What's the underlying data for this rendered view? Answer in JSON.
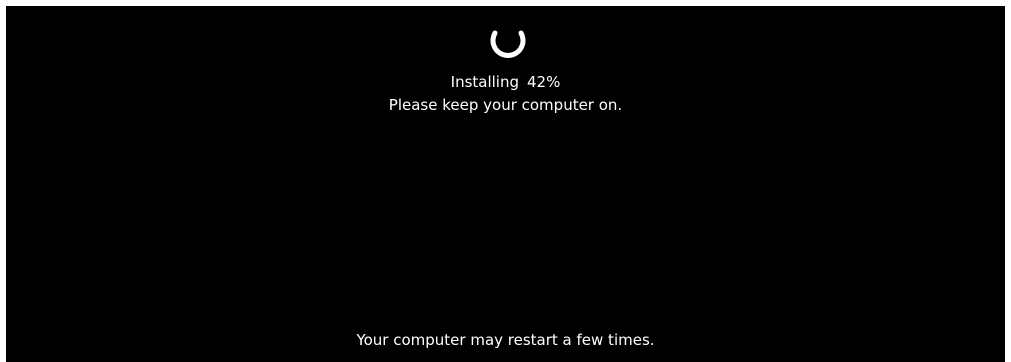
{
  "installer": {
    "status_label": "Installing",
    "progress_text": "42%",
    "progress_fraction": 0.42,
    "instruction": "Please keep your computer on.",
    "footer_note": "Your computer may restart a few times."
  },
  "icons": {
    "spinner": "loading-spinner-icon"
  },
  "colors": {
    "background": "#000000",
    "text": "#ffffff"
  }
}
